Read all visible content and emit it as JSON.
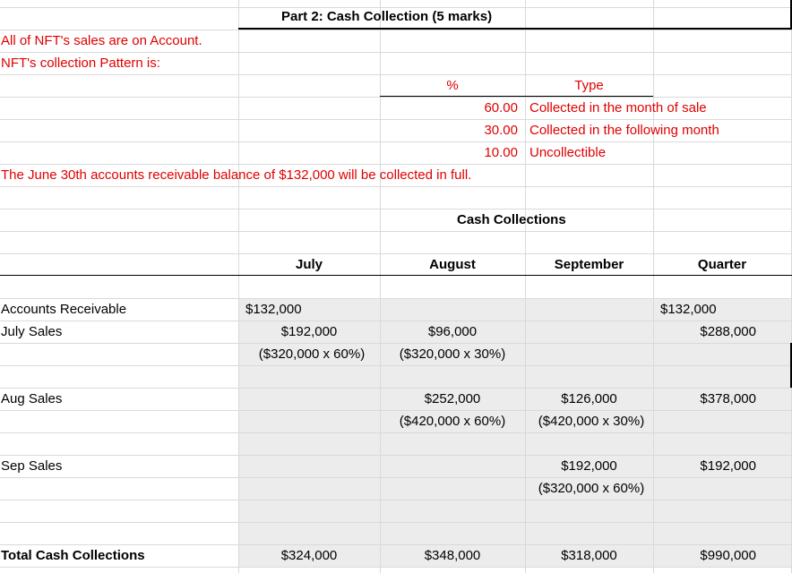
{
  "title": "Part 2: Cash Collection (5 marks)",
  "notes": {
    "line1": "All of NFT's sales are on Account.",
    "line2": "NFT's collection Pattern is:",
    "balance_note": "The June 30th accounts receivable balance of $132,000 will be collected in full."
  },
  "pattern": {
    "headers": {
      "pct": "%",
      "type": "Type"
    },
    "rows": [
      {
        "pct": "60.00",
        "type": "Collected in the month of sale"
      },
      {
        "pct": "30.00",
        "type": "Collected in the following month"
      },
      {
        "pct": "10.00",
        "type": "Uncollectible"
      }
    ]
  },
  "schedule": {
    "title": "Cash Collections",
    "columns": [
      "July",
      "August",
      "September",
      "Quarter"
    ],
    "accounts_receivable": {
      "label": "Accounts Receivable",
      "july": "$132,000",
      "quarter": "$132,000"
    },
    "july_sales": {
      "label": "July Sales",
      "july": "$192,000",
      "july_calc": "($320,000 x 60%)",
      "august": "$96,000",
      "august_calc": "($320,000 x 30%)",
      "quarter": "$288,000"
    },
    "aug_sales": {
      "label": "Aug Sales",
      "august": "$252,000",
      "august_calc": "($420,000 x 60%)",
      "september": "$126,000",
      "september_calc": "($420,000 x 30%)",
      "quarter": "$378,000"
    },
    "sep_sales": {
      "label": "Sep Sales",
      "september": "$192,000",
      "september_calc": "($320,000 x 60%)",
      "quarter": "$192,000"
    },
    "total": {
      "label": "Total Cash Collections",
      "july": "$324,000",
      "august": "$348,000",
      "september": "$318,000",
      "quarter": "$990,000"
    }
  }
}
